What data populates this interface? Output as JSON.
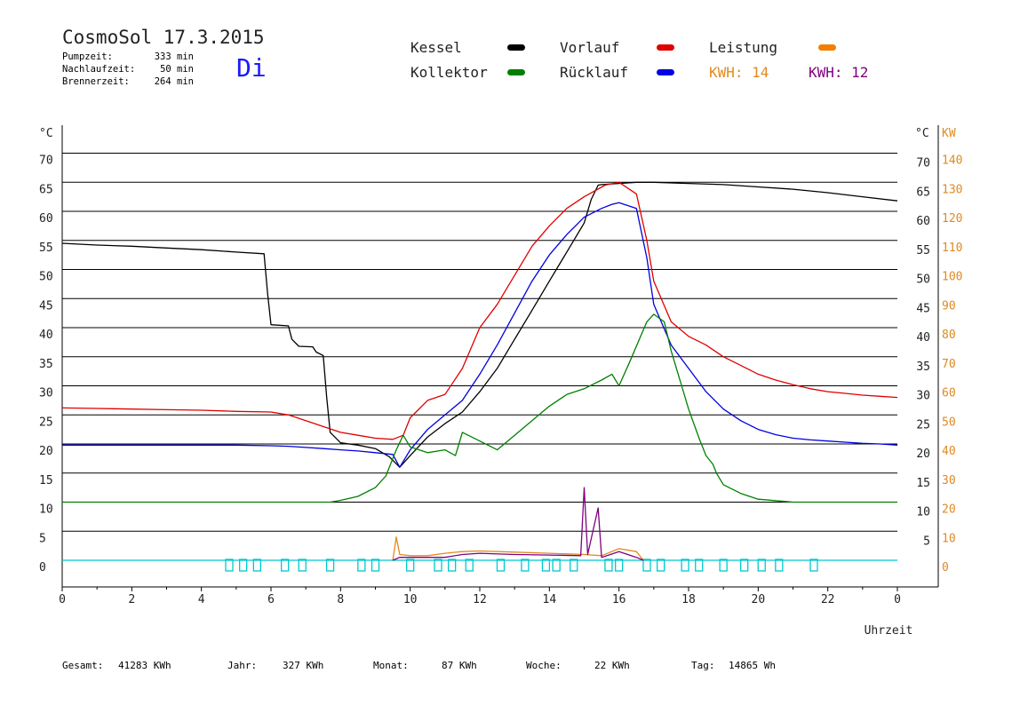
{
  "header": {
    "title": "CosmoSol 17.3.2015",
    "day": "Di",
    "stats": [
      {
        "label": "Pumpzeit:",
        "value": "333 min"
      },
      {
        "label": "Nachlaufzeit:",
        "value": "50 min"
      },
      {
        "label": "Brennerzeit:",
        "value": "264 min"
      }
    ]
  },
  "legend": {
    "kessel": {
      "label": "Kessel",
      "color": "#000000"
    },
    "vorlauf": {
      "label": "Vorlauf",
      "color": "#e00000"
    },
    "leistung": {
      "label": "Leistung",
      "color": "#f08000"
    },
    "kollektor": {
      "label": "Kollektor",
      "color": "#008000"
    },
    "ruecklauf": {
      "label": "Rücklauf",
      "color": "#0000e0"
    },
    "kwh1": "KWH: 14",
    "kwh2": "KWH: 12",
    "kwh1_color": "#e08a20",
    "kwh2_color": "#800080"
  },
  "footer": {
    "gesamt_label": "Gesamt:",
    "gesamt_value": "41283 KWh",
    "jahr_label": "Jahr:",
    "jahr_value": "327 KWh",
    "monat_label": "Monat:",
    "monat_value": "87 KWh",
    "woche_label": "Woche:",
    "woche_value": "22 KWh",
    "tag_label": "Tag:",
    "tag_value": "14865 Wh"
  },
  "chart_data": {
    "type": "line",
    "xlabel": "Uhrzeit",
    "ylabel_left": "°C",
    "ylabel_right_unit_1": "°C",
    "ylabel_right_unit_2": "KW",
    "xlim": [
      0,
      24
    ],
    "ylim": [
      -2.5,
      75
    ],
    "xticks": [
      "0",
      "2",
      "4",
      "6",
      "8",
      "10",
      "12",
      "14",
      "16",
      "18",
      "20",
      "22",
      "0"
    ],
    "yticks_left": [
      "0",
      "5",
      "10",
      "15",
      "20",
      "25",
      "30",
      "35",
      "40",
      "45",
      "50",
      "55",
      "60",
      "65",
      "70"
    ],
    "yticks_right_c": [
      "",
      "5",
      "10",
      "15",
      "20",
      "25",
      "30",
      "35",
      "40",
      "45",
      "50",
      "55",
      "60",
      "65",
      "70"
    ],
    "yticks_right_kw": [
      "0",
      "10",
      "20",
      "30",
      "40",
      "50",
      "60",
      "70",
      "80",
      "90",
      "100",
      "110",
      "120",
      "130",
      "140"
    ],
    "grid": "horizontal",
    "series": [
      {
        "name": "Kessel",
        "color": "#000000",
        "points": [
          [
            0,
            54.5
          ],
          [
            1,
            54.2
          ],
          [
            2,
            54
          ],
          [
            3,
            53.7
          ],
          [
            4,
            53.4
          ],
          [
            5,
            53
          ],
          [
            5.8,
            52.7
          ],
          [
            5.9,
            46
          ],
          [
            6,
            40.5
          ],
          [
            6.5,
            40.3
          ],
          [
            6.6,
            38
          ],
          [
            6.8,
            36.8
          ],
          [
            7.2,
            36.7
          ],
          [
            7.3,
            35.8
          ],
          [
            7.5,
            35.2
          ],
          [
            7.6,
            28
          ],
          [
            7.7,
            22
          ],
          [
            8,
            20.2
          ],
          [
            8.5,
            19.8
          ],
          [
            9,
            19.2
          ],
          [
            9.4,
            17.8
          ],
          [
            9.7,
            16
          ],
          [
            10,
            18
          ],
          [
            10.5,
            21.2
          ],
          [
            11,
            23.5
          ],
          [
            11.5,
            25.5
          ],
          [
            12,
            29
          ],
          [
            12.5,
            33
          ],
          [
            13,
            38
          ],
          [
            13.5,
            43
          ],
          [
            14,
            48
          ],
          [
            14.5,
            53
          ],
          [
            15,
            58
          ],
          [
            15.2,
            62
          ],
          [
            15.4,
            64.5
          ],
          [
            15.5,
            64.6
          ],
          [
            16,
            64.8
          ],
          [
            16.5,
            65
          ],
          [
            17,
            65
          ],
          [
            18,
            64.8
          ],
          [
            19,
            64.6
          ],
          [
            20,
            64.2
          ],
          [
            21,
            63.8
          ],
          [
            22,
            63.2
          ],
          [
            23,
            62.5
          ],
          [
            24,
            61.8
          ]
        ]
      },
      {
        "name": "Vorlauf",
        "color": "#e00000",
        "points": [
          [
            0,
            26.2
          ],
          [
            1,
            26.1
          ],
          [
            2,
            26
          ],
          [
            3,
            25.9
          ],
          [
            4,
            25.8
          ],
          [
            5,
            25.6
          ],
          [
            6,
            25.5
          ],
          [
            6.5,
            25
          ],
          [
            7,
            24
          ],
          [
            7.5,
            23
          ],
          [
            8,
            22
          ],
          [
            8.5,
            21.5
          ],
          [
            9,
            21
          ],
          [
            9.5,
            20.8
          ],
          [
            9.8,
            21.5
          ],
          [
            10,
            24.5
          ],
          [
            10.5,
            27.5
          ],
          [
            11,
            28.5
          ],
          [
            11.5,
            33
          ],
          [
            12,
            40
          ],
          [
            12.5,
            44
          ],
          [
            13,
            49
          ],
          [
            13.5,
            54
          ],
          [
            14,
            57.5
          ],
          [
            14.5,
            60.5
          ],
          [
            15,
            62.5
          ],
          [
            15.3,
            63.5
          ],
          [
            15.6,
            64.5
          ],
          [
            16,
            65
          ],
          [
            16.5,
            63
          ],
          [
            16.8,
            55
          ],
          [
            17,
            48
          ],
          [
            17.5,
            41
          ],
          [
            18,
            38.5
          ],
          [
            18.5,
            37
          ],
          [
            19,
            35
          ],
          [
            19.5,
            33.5
          ],
          [
            20,
            32
          ],
          [
            20.5,
            31
          ],
          [
            21,
            30.2
          ],
          [
            21.5,
            29.5
          ],
          [
            22,
            29
          ],
          [
            22.5,
            28.7
          ],
          [
            23,
            28.4
          ],
          [
            23.5,
            28.2
          ],
          [
            24,
            28
          ]
        ]
      },
      {
        "name": "Rücklauf",
        "color": "#0000e0",
        "points": [
          [
            0,
            19.8
          ],
          [
            1,
            19.8
          ],
          [
            2,
            19.8
          ],
          [
            3,
            19.8
          ],
          [
            4,
            19.8
          ],
          [
            5,
            19.8
          ],
          [
            6,
            19.7
          ],
          [
            6.5,
            19.6
          ],
          [
            7,
            19.4
          ],
          [
            7.5,
            19.2
          ],
          [
            8,
            19
          ],
          [
            8.5,
            18.8
          ],
          [
            9,
            18.5
          ],
          [
            9.5,
            18.2
          ],
          [
            9.7,
            16
          ],
          [
            10,
            19
          ],
          [
            10.5,
            22.5
          ],
          [
            11,
            25
          ],
          [
            11.5,
            27.5
          ],
          [
            12,
            32
          ],
          [
            12.5,
            37
          ],
          [
            13,
            42.5
          ],
          [
            13.5,
            48
          ],
          [
            14,
            52.5
          ],
          [
            14.5,
            56
          ],
          [
            15,
            59
          ],
          [
            15.5,
            60.5
          ],
          [
            15.8,
            61.2
          ],
          [
            16,
            61.5
          ],
          [
            16.5,
            60.5
          ],
          [
            16.8,
            52
          ],
          [
            17,
            44
          ],
          [
            17.5,
            37
          ],
          [
            18,
            33
          ],
          [
            18.5,
            29
          ],
          [
            19,
            26
          ],
          [
            19.5,
            24
          ],
          [
            20,
            22.5
          ],
          [
            20.5,
            21.6
          ],
          [
            21,
            21
          ],
          [
            21.5,
            20.7
          ],
          [
            22,
            20.5
          ],
          [
            22.5,
            20.3
          ],
          [
            23,
            20.1
          ],
          [
            23.5,
            20
          ],
          [
            24,
            19.8
          ]
        ]
      },
      {
        "name": "Kollektor",
        "color": "#008000",
        "points": [
          [
            0,
            10
          ],
          [
            1,
            10
          ],
          [
            2,
            10
          ],
          [
            3,
            10
          ],
          [
            4,
            10
          ],
          [
            5,
            10
          ],
          [
            6,
            10
          ],
          [
            7,
            10
          ],
          [
            7.7,
            10
          ],
          [
            8,
            10.3
          ],
          [
            8.5,
            11
          ],
          [
            9,
            12.5
          ],
          [
            9.3,
            14.5
          ],
          [
            9.6,
            19
          ],
          [
            9.8,
            21.5
          ],
          [
            10,
            19.5
          ],
          [
            10.5,
            18.5
          ],
          [
            11,
            19
          ],
          [
            11.3,
            18
          ],
          [
            11.5,
            22
          ],
          [
            12,
            20.5
          ],
          [
            12.5,
            19
          ],
          [
            13,
            21.5
          ],
          [
            13.5,
            24
          ],
          [
            14,
            26.5
          ],
          [
            14.5,
            28.5
          ],
          [
            15,
            29.5
          ],
          [
            15.5,
            31
          ],
          [
            15.8,
            32
          ],
          [
            16,
            30
          ],
          [
            16.3,
            34
          ],
          [
            16.8,
            41
          ],
          [
            17,
            42.3
          ],
          [
            17.3,
            41
          ],
          [
            17.5,
            36
          ],
          [
            17.8,
            30
          ],
          [
            18,
            26
          ],
          [
            18.3,
            21
          ],
          [
            18.5,
            18
          ],
          [
            18.7,
            16.5
          ],
          [
            18.8,
            15
          ],
          [
            19,
            13
          ],
          [
            19.5,
            11.5
          ],
          [
            20,
            10.5
          ],
          [
            21,
            10
          ],
          [
            22,
            10
          ],
          [
            23,
            10
          ],
          [
            24,
            10
          ]
        ]
      },
      {
        "name": "Leistung",
        "color": "#e08a20",
        "points": [
          [
            9.5,
            0
          ],
          [
            9.6,
            4
          ],
          [
            9.7,
            1
          ],
          [
            10,
            0.8
          ],
          [
            10.5,
            0.8
          ],
          [
            11,
            1.2
          ],
          [
            11.5,
            1.5
          ],
          [
            12,
            1.6
          ],
          [
            13,
            1.4
          ],
          [
            14,
            1.2
          ],
          [
            15,
            1
          ],
          [
            15.5,
            0.8
          ],
          [
            16,
            2
          ],
          [
            16.5,
            1.5
          ],
          [
            16.7,
            0
          ]
        ]
      },
      {
        "name": "KWH2",
        "color": "#800080",
        "points": [
          [
            9.5,
            0
          ],
          [
            9.7,
            0.5
          ],
          [
            10,
            0.5
          ],
          [
            11,
            0.5
          ],
          [
            11.5,
            1
          ],
          [
            12,
            1.2
          ],
          [
            13,
            1
          ],
          [
            14,
            0.9
          ],
          [
            14.9,
            0.8
          ],
          [
            15,
            12.5
          ],
          [
            15.1,
            1
          ],
          [
            15.4,
            9
          ],
          [
            15.5,
            0.5
          ],
          [
            16,
            1.5
          ],
          [
            16.5,
            0.5
          ],
          [
            16.7,
            0
          ]
        ]
      }
    ],
    "marker_series": {
      "name": "Pumpe",
      "color": "#00c8d0",
      "y": 0,
      "x": [
        4.8,
        5.2,
        5.6,
        6.4,
        6.9,
        7.7,
        8.6,
        9,
        10,
        10.8,
        11.2,
        11.7,
        12.6,
        13.3,
        13.9,
        14.2,
        14.7,
        15.7,
        16,
        16.8,
        17.2,
        17.9,
        18.3,
        19,
        19.6,
        20.1,
        20.6,
        21.6
      ]
    }
  }
}
